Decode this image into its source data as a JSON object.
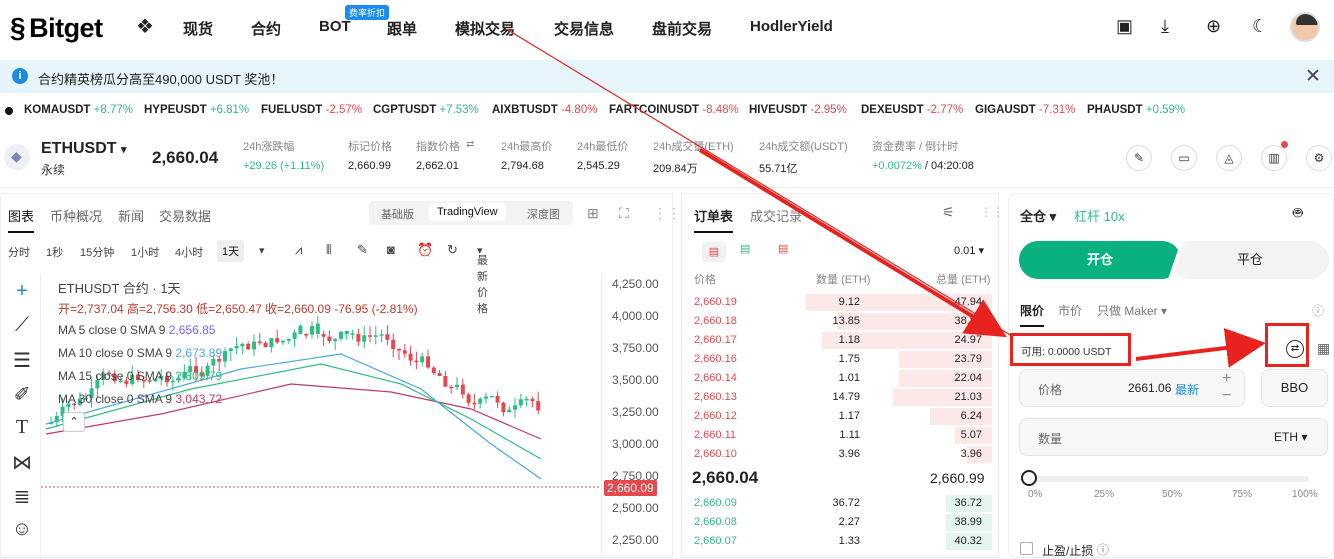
{
  "header": {
    "logo": "Bitget",
    "nav": [
      "现货",
      "合约",
      "BOT",
      "跟单",
      "模拟交易",
      "交易信息",
      "盘前交易",
      "HodlerYield"
    ],
    "bot_badge": "费率折扣"
  },
  "announcement": {
    "text": "合约精英榜瓜分高至490,000 USDT 奖池！"
  },
  "ticker": [
    {
      "sym": "KOMAUSDT",
      "chg": "+8.77%"
    },
    {
      "sym": "HYPEUSDT",
      "chg": "+6.81%"
    },
    {
      "sym": "FUELUSDT",
      "chg": "-2.57%"
    },
    {
      "sym": "CGPTUSDT",
      "chg": "+7.53%"
    },
    {
      "sym": "AIXBTUSDT",
      "chg": "-4.80%"
    },
    {
      "sym": "FARTCOINUSDT",
      "chg": "-8.48%"
    },
    {
      "sym": "HIVEUSDT",
      "chg": "-2.95%"
    },
    {
      "sym": "DEXEUSDT",
      "chg": "-2.77%"
    },
    {
      "sym": "GIGAUSDT",
      "chg": "-7.31%"
    },
    {
      "sym": "PHAUSDT",
      "chg": "+0.59%"
    }
  ],
  "instrument": {
    "symbol": "ETHUSDT",
    "type": "永续",
    "price": "2,660.04",
    "stats": [
      {
        "label": "24h涨跌幅",
        "value": "+29.26 (+1.11%)"
      },
      {
        "label": "标记价格",
        "value": "2,660.99"
      },
      {
        "label": "指数价格",
        "value": "2,662.01"
      },
      {
        "label": "24h最高价",
        "value": "2,794.68"
      },
      {
        "label": "24h最低价",
        "value": "2,545.29"
      },
      {
        "label": "24h成交量(ETH)",
        "value": "209.84万"
      },
      {
        "label": "24h成交额(USDT)",
        "value": "55.71亿"
      },
      {
        "label": "资金费率 / 倒计时",
        "value": "+0.0072%",
        "value2": "/ 04:20:08"
      }
    ]
  },
  "chart": {
    "tabs": [
      "图表",
      "币种概况",
      "新闻",
      "交易数据"
    ],
    "views": [
      "基础版",
      "TradingView",
      "深度图"
    ],
    "intervals": [
      "分时",
      "1秒",
      "15分钟",
      "1小时",
      "4小时",
      "1天"
    ],
    "price_type": "最新价格",
    "title": "ETHUSDT 合约 · 1天",
    "ohlc": "开=2,737.04  高=2,756.30  低=2,650.47  收=2,660.09  -76.95 (-2.81%)",
    "ma": [
      {
        "label": "MA 5 close 0 SMA 9",
        "value": "2,656.85",
        "color": "#7b61ff"
      },
      {
        "label": "MA 10 close 0 SMA 9",
        "value": "2,673.89",
        "color": "#4aa8e0"
      },
      {
        "label": "MA 15 close 0 SMA 9",
        "value": "2,809.79",
        "color": "#2ebd85"
      },
      {
        "label": "MA 30 close 0 SMA 9",
        "value": "3,043.72",
        "color": "#c0396b"
      }
    ],
    "y_ticks": [
      "4,250.00",
      "4,000.00",
      "3,750.00",
      "3,500.00",
      "3,250.00",
      "3,000.00",
      "2,750.00",
      "2,500.00",
      "2,250.00"
    ],
    "last_price": "2,660.09"
  },
  "orderbook": {
    "tabs": [
      "订单表",
      "成交记录"
    ],
    "precision": "0.01",
    "headers": [
      "价格",
      "数量 (ETH)",
      "总量 (ETH)"
    ],
    "asks": [
      [
        "2,660.19",
        "9.12",
        "47.94"
      ],
      [
        "2,660.18",
        "13.85",
        "38.82"
      ],
      [
        "2,660.17",
        "1.18",
        "24.97"
      ],
      [
        "2,660.16",
        "1.75",
        "23.79"
      ],
      [
        "2,660.14",
        "1.01",
        "22.04"
      ],
      [
        "2,660.13",
        "14.79",
        "21.03"
      ],
      [
        "2,660.12",
        "1.17",
        "6.24"
      ],
      [
        "2,660.11",
        "1.11",
        "5.07"
      ],
      [
        "2,660.10",
        "3.96",
        "3.96"
      ]
    ],
    "mid": "2,660.04",
    "mark": "2,660.99",
    "bids": [
      [
        "2,660.09",
        "36.72",
        "36.72"
      ],
      [
        "2,660.08",
        "2.27",
        "38.99"
      ],
      [
        "2,660.07",
        "1.33",
        "40.32"
      ]
    ]
  },
  "trade": {
    "margin_mode": "全仓",
    "leverage": "杠杆 10x",
    "open": "开仓",
    "close": "平仓",
    "order_types": [
      "限价",
      "市价",
      "只做 Maker"
    ],
    "available": "可用: 0.0000 USDT",
    "price_label": "价格",
    "price_value": "2661.06",
    "price_latest": "最新",
    "bbo": "BBO",
    "qty_label": "数量",
    "qty_unit": "ETH",
    "slider": [
      "0%",
      "25%",
      "50%",
      "75%",
      "100%"
    ],
    "tpsl": "止盈/止损"
  }
}
